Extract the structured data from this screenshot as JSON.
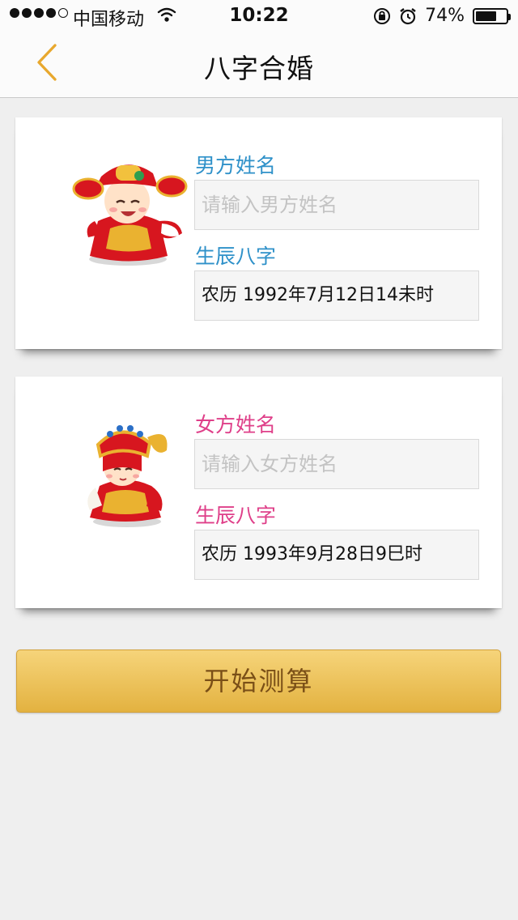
{
  "status_bar": {
    "carrier": "中国移动",
    "time": "10:22",
    "battery_percent": "74%",
    "battery_level": 0.74
  },
  "nav": {
    "title": "八字合婚"
  },
  "male": {
    "name_label": "男方姓名",
    "name_placeholder": "请输入男方姓名",
    "bazi_label": "生辰八字",
    "bazi_value": "农历 1992年7月12日14未时"
  },
  "female": {
    "name_label": "女方姓名",
    "name_placeholder": "请输入女方姓名",
    "bazi_label": "生辰八字",
    "bazi_value": "农历 1993年9月28日9巳时"
  },
  "actions": {
    "start_label": "开始测算"
  },
  "colors": {
    "male_label": "#2f91c9",
    "female_label": "#df3f89",
    "accent": "#e8b84e"
  }
}
